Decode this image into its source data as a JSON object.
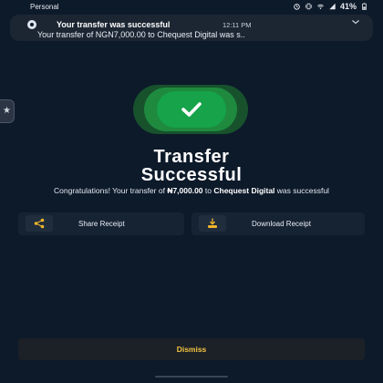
{
  "status_bar": {
    "carrier": "Personal",
    "battery": "41%",
    "icons": [
      "alarm-icon",
      "vibrate-icon",
      "wifi-icon",
      "signal-icon",
      "battery-icon"
    ]
  },
  "notification": {
    "title": "Your transfer was successful",
    "time": "12:11 PM",
    "body": "Your transfer of NGN7,000.00 to Chequest Digital was s..",
    "icon": "app-icon"
  },
  "side_tab": {
    "glyph": "★"
  },
  "success_icon": "check-icon",
  "heading": {
    "line1": "Transfer",
    "line2": "Successful"
  },
  "message": {
    "prefix": "Congratulations! Your transfer of ",
    "amount": "₦7,000.00",
    "middle": " to ",
    "recipient": "Chequest Digital",
    "suffix": " was successful"
  },
  "actions": {
    "share_label": "Share Receipt",
    "download_label": "Download Receipt"
  },
  "dismiss_label": "Dismiss",
  "colors": {
    "background": "#0d1a2a",
    "success_green": "#16a34a",
    "dismiss_text": "#f4c542",
    "download_icon": "#f0b429"
  }
}
